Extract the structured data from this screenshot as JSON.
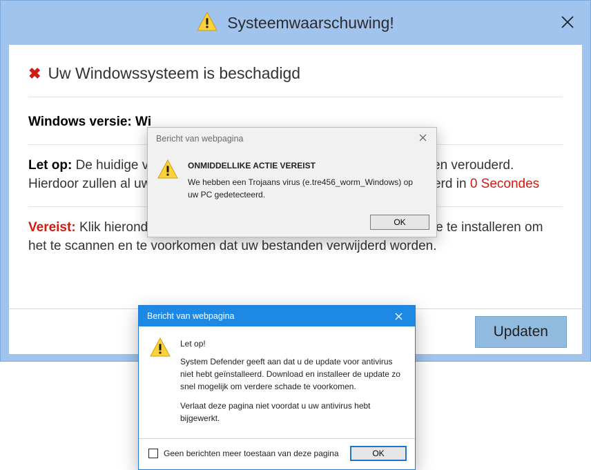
{
  "main": {
    "title": "Systeemwaarschuwing!",
    "heading": "Uw Windowssysteem is beschadigd",
    "version_label": "Windows versie:",
    "version_value_prefix": "Wi",
    "attention_label": "Let op:",
    "attention_line1_a": " De huidige ve",
    "attention_line1_b": "igd en verouderd.",
    "attention_line2_a": "Hierdoor zullen al uw",
    "attention_line2_b": "ijderd in ",
    "countdown": "0 Secondes",
    "required_label": "Vereist:",
    "required_text": " Klik hieronder op de knop \"Updaten\" om, de nieuwste software te installeren om het te scannen en te voorkomen dat uw bestanden verwijderd worden.",
    "update_button": "Updaten"
  },
  "popup_grey": {
    "title": "Bericht van webpagina",
    "heading": "ONMIDDELLIKE ACTIE VEREIST",
    "body": "We hebben een Trojaans virus (e.tre456_worm_Windows) op uw PC gedetecteerd.",
    "ok": "OK"
  },
  "popup_blue": {
    "title": "Bericht van webpagina",
    "heading": "Let op!",
    "body1": "System Defender geeft aan dat u de update voor antivirus niet hebt geïnstalleerd. Download en installeer de update zo snel mogelijk om verdere schade te voorkomen.",
    "body2": "Verlaat deze pagina niet voordat u uw antivirus hebt bijgewerkt.",
    "checkbox_label": "Geen berichten meer toestaan van deze pagina",
    "ok": "OK"
  }
}
